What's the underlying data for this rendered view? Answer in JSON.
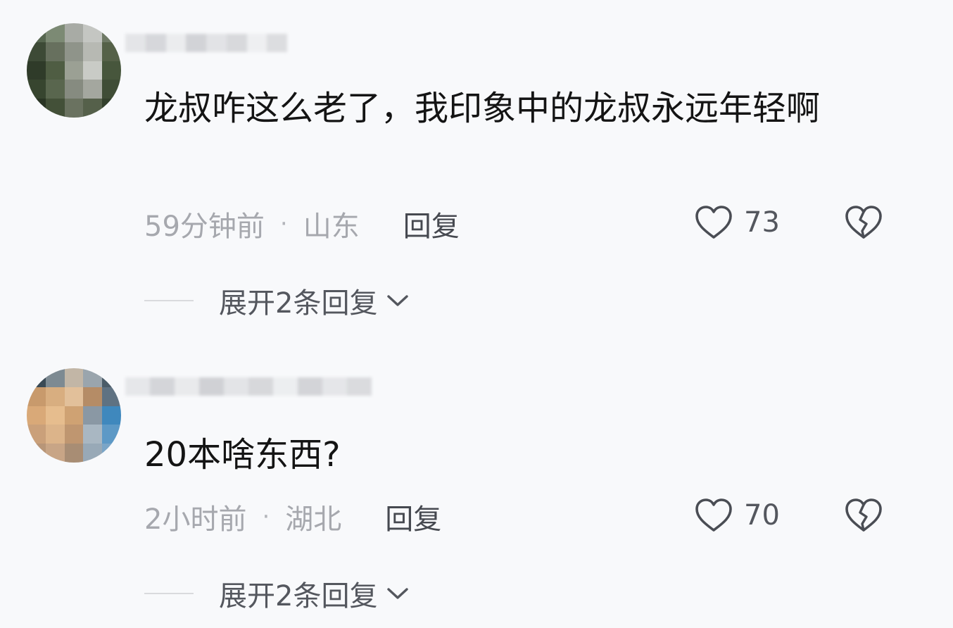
{
  "comments": [
    {
      "text": "龙叔咋这么老了，我印象中的龙叔永远年轻啊",
      "time": "59分钟前",
      "separator": "·",
      "location": "山东",
      "reply_label": "回复",
      "likes": "73",
      "expand_label": "展开2条回复"
    },
    {
      "text": "20本啥东西?",
      "time": "2小时前",
      "separator": "·",
      "location": "湖北",
      "reply_label": "回复",
      "likes": "70",
      "expand_label": "展开2条回复"
    }
  ],
  "icons": {
    "like": "heart-outline-icon",
    "dislike": "broken-heart-icon",
    "expand": "chevron-down-icon"
  },
  "colors": {
    "background": "#f8f9fb",
    "text": "#141414",
    "meta": "#a6a8ae",
    "action": "#54575e"
  }
}
